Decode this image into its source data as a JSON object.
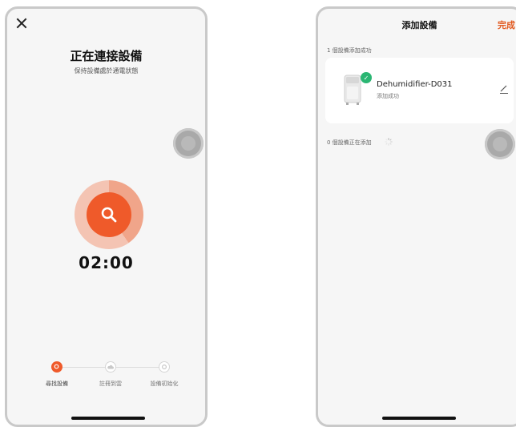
{
  "left_screen": {
    "title": "正在連接設備",
    "subtitle": "保持設備處於通電狀態",
    "timer": "02:00",
    "steps": [
      {
        "label": "尋找設備",
        "active": true
      },
      {
        "label": "註冊到雲",
        "active": false
      },
      {
        "label": "設備初始化",
        "active": false
      }
    ]
  },
  "right_screen": {
    "title": "添加設備",
    "done_label": "完成",
    "success_section": "1 個設備添加成功",
    "device": {
      "name": "Dehumidifier-D031",
      "status": "添加成功"
    },
    "pending_section": "0 個設備正在添加"
  },
  "colors": {
    "accent": "#ef5a2a",
    "done": "#e25a20",
    "success": "#2bb673"
  },
  "icons": [
    "close-icon",
    "search-icon",
    "cloud-icon",
    "gear-icon",
    "check-icon",
    "edit-icon",
    "spinner-icon"
  ]
}
